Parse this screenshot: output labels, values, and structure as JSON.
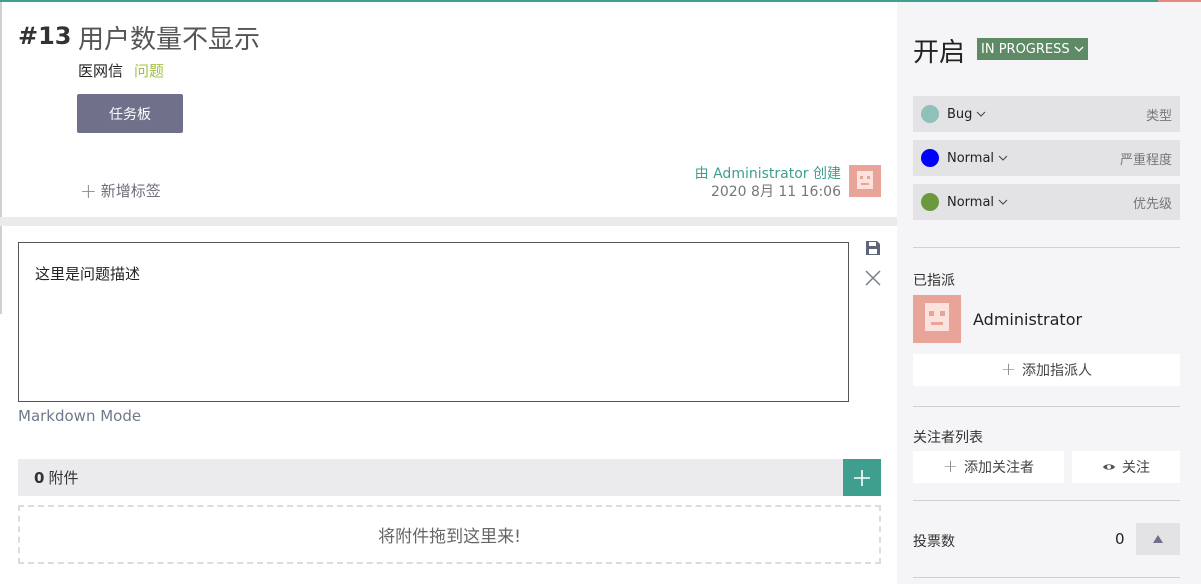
{
  "issue": {
    "ref": "#13",
    "subject": "用户数量不显示",
    "project": "医网信",
    "type_link": "问题",
    "taskboard_label": "任务板",
    "add_tag_label": "新增标签",
    "created_by": "由 Administrator 创建",
    "created_date": "2020 8月 11 16:06",
    "description": "这里是问题描述",
    "markdown_mode_label": "Markdown Mode"
  },
  "attachments": {
    "count": "0",
    "label": "附件",
    "drop_text": "将附件拖到这里来!"
  },
  "sidebar": {
    "status_title": "开启",
    "status_badge": "IN PROGRESS",
    "attributes": [
      {
        "value": "Bug",
        "label": "类型",
        "color": "#8fc0b9"
      },
      {
        "value": "Normal",
        "label": "严重程度",
        "color": "#0000ff"
      },
      {
        "value": "Normal",
        "label": "优先级",
        "color": "#6b9a3e"
      }
    ],
    "assigned_label": "已指派",
    "assignee_name": "Administrator",
    "add_assignee_label": "添加指派人",
    "watchers_label": "关注者列表",
    "add_watcher_label": "添加关注者",
    "watch_label": "关注",
    "votes_label": "投票数",
    "votes_count": "0"
  },
  "colors": {
    "accent": "#3e9f8e",
    "badge": "#5e8a66",
    "button": "#6f7089"
  }
}
